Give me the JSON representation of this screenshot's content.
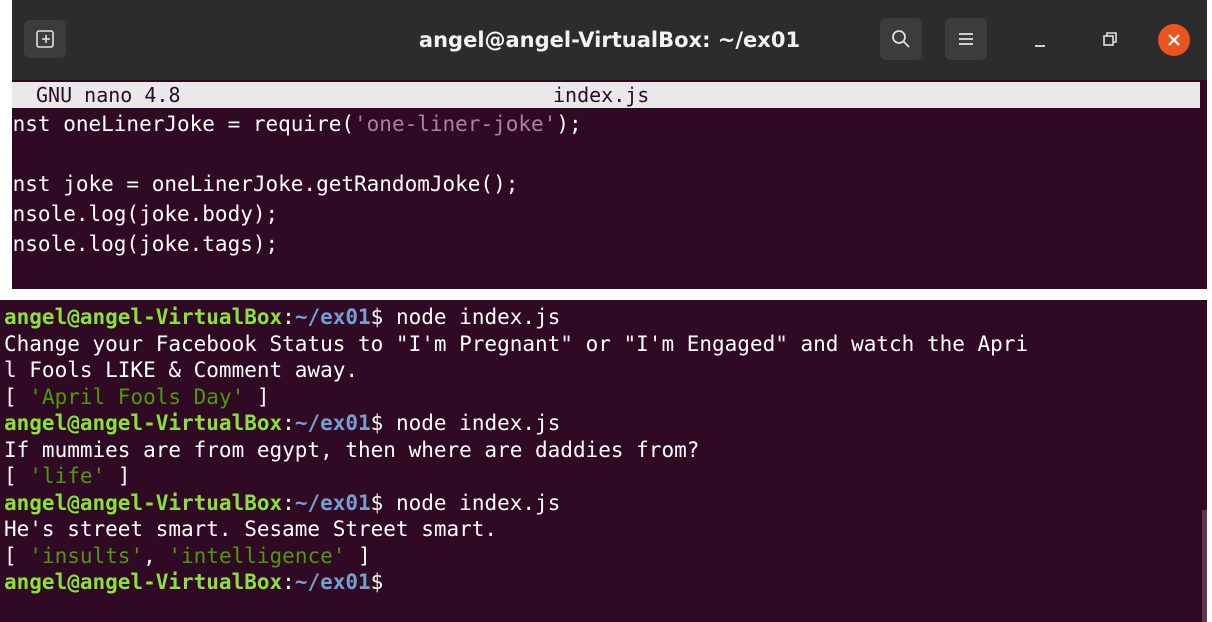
{
  "window": {
    "title": "angel@angel-VirtualBox: ~/ex01",
    "new_tab_icon": "new-tab-icon",
    "search_icon": "search-icon",
    "menu_icon": "hamburger-menu-icon",
    "minimize_icon": "minimize-icon",
    "maximize_icon": "maximize-icon",
    "close_icon": "close-icon"
  },
  "nano": {
    "version": "GNU nano 4.8",
    "filename": "index.js",
    "lines": {
      "l1_a": "onst oneLinerJoke = require(",
      "l1_str": "'one-liner-joke'",
      "l1_b": ");",
      "l2": "",
      "l3": "onst joke = oneLinerJoke.getRandomJoke();",
      "l4": "onsole.log(joke.body);",
      "l5": "onsole.log(joke.tags);"
    }
  },
  "terminal": {
    "prompt": {
      "user": "angel@angel-VirtualBox",
      "sep": ":",
      "path": "~/ex01",
      "dollar": "$"
    },
    "command": " node index.js",
    "outputs": {
      "joke1_line1": "Change your Facebook Status to \"I'm Pregnant\" or \"I'm Engaged\" and watch the Apri",
      "joke1_line2": "l Fools LIKE & Comment away.",
      "tags1_open": "[ ",
      "tags1_v1": "'April Fools Day'",
      "tags1_close": " ]",
      "joke2": "If mummies are from egypt, then where are daddies from?",
      "tags2_open": "[ ",
      "tags2_v1": "'life'",
      "tags2_close": " ]",
      "joke3": "He's street smart. Sesame Street smart.",
      "tags3_open": "[ ",
      "tags3_v1": "'insults'",
      "tags3_comma": ", ",
      "tags3_v2": "'intelligence'",
      "tags3_close": " ]"
    }
  }
}
